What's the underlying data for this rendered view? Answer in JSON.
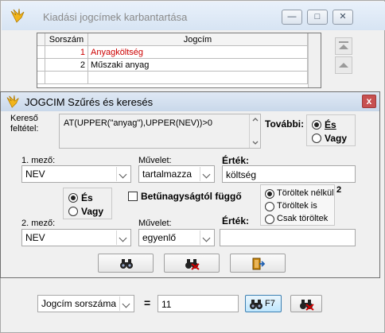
{
  "background_window": {
    "title": "Kiadási jogcímek karbantartása",
    "buttons": {
      "minimize": "—",
      "maximize": "□",
      "close": "✕"
    },
    "grid": {
      "columns": [
        "Sorszám",
        "Jogcím"
      ],
      "rows": [
        {
          "num": "1",
          "name": "Anyagköltség"
        },
        {
          "num": "2",
          "name": "Műszaki anyag"
        }
      ]
    },
    "bottom": {
      "field_combo": "Jogcím sorszáma",
      "operator": "=",
      "value": "11",
      "f7_label": "F7"
    }
  },
  "dialog": {
    "title": "JOGCIM Szűrés és keresés",
    "close": "x",
    "criteria_label_1": "Kereső",
    "criteria_label_2": "feltétel:",
    "criteria_value": "AT(UPPER(\"anyag\"),UPPER(NEV))>0",
    "further_label": "További:",
    "further_and": "És",
    "further_or": "Vagy",
    "field1_label": "1. mező:",
    "field1_value": "NEV",
    "op1_label": "Művelet:",
    "op1_value": "tartalmazza",
    "value1_label": "Érték:",
    "value1": "költség",
    "logic_and": "És",
    "logic_or": "Vagy",
    "case_label": "Betűnagyságtól függő",
    "deleted_options": [
      "Töröltek nélkül",
      "Töröltek is",
      "Csak töröltek"
    ],
    "deleted_count": "2",
    "field2_label": "2. mező:",
    "field2_value": "NEV",
    "op2_label": "Művelet:",
    "op2_value": "egyenlő",
    "value2_label": "Érték:",
    "value2": ""
  },
  "colors": {
    "highlight_row": "#cc0000"
  }
}
